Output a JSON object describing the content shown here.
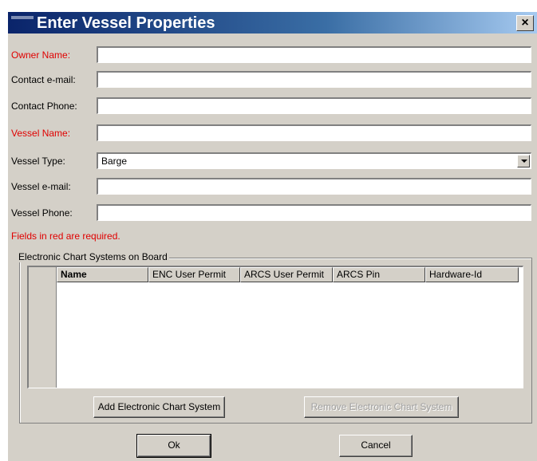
{
  "dialog": {
    "title": "Enter Vessel Properties",
    "close_label": "×"
  },
  "form": {
    "owner_name": {
      "label": "Owner Name:",
      "value": "",
      "required": true
    },
    "contact_email": {
      "label": "Contact e-mail:",
      "value": "",
      "required": false
    },
    "contact_phone": {
      "label": "Contact Phone:",
      "value": "",
      "required": false
    },
    "vessel_name": {
      "label": "Vessel Name:",
      "value": "",
      "required": true
    },
    "vessel_type": {
      "label": "Vessel Type:",
      "value": "Barge",
      "required": false
    },
    "vessel_email": {
      "label": "Vessel e-mail:",
      "value": "",
      "required": false
    },
    "vessel_phone": {
      "label": "Vessel Phone:",
      "value": "",
      "required": false
    },
    "required_note": "Fields in red are required."
  },
  "ecs_group": {
    "title": "Electronic Chart Systems on Board",
    "columns": [
      "Name",
      "ENC User Permit",
      "ARCS User Permit",
      "ARCS Pin",
      "Hardware-Id"
    ],
    "rows": [],
    "add_button": "Add Electronic Chart System",
    "remove_button": "Remove Electronic Chart System"
  },
  "buttons": {
    "ok": "Ok",
    "cancel": "Cancel"
  },
  "colors": {
    "required": "#e00000",
    "title_gradient_start": "#0a246a",
    "title_gradient_end": "#a6caf0",
    "face": "#d4d0c8"
  }
}
